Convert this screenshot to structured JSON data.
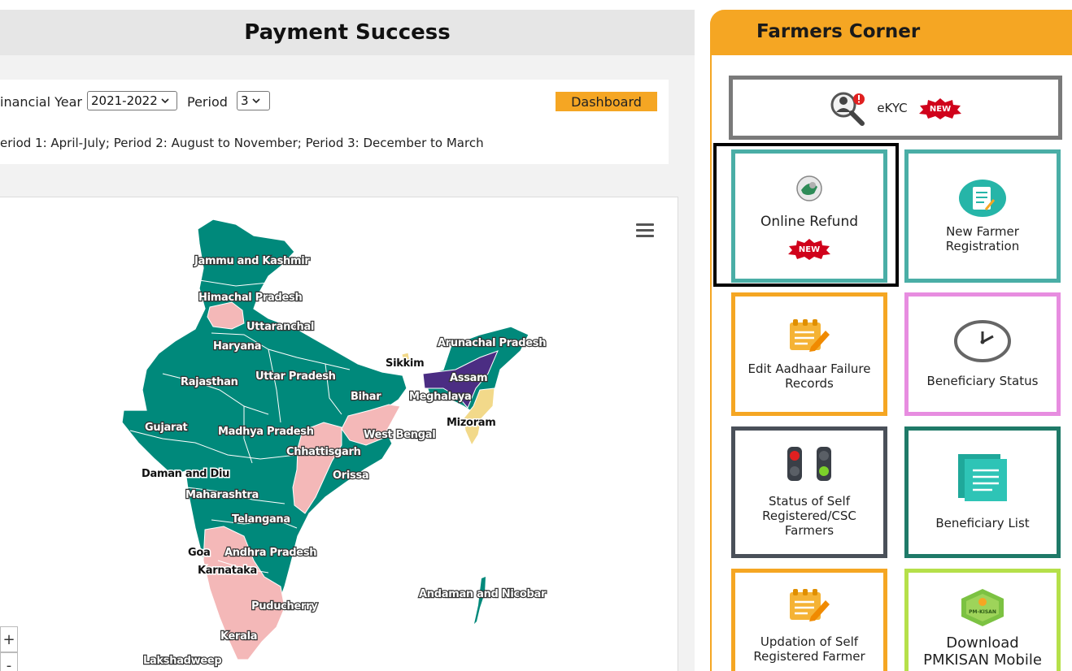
{
  "left": {
    "title": "Payment Success",
    "financial_year_label": "inancial Year",
    "financial_year_value": "2021-2022",
    "period_label": "Period",
    "period_value": "3",
    "dashboard_label": "Dashboard",
    "period_note": "eriod 1: April-July; Period 2: August to November; Period 3: December to March"
  },
  "map": {
    "zoom_in": "+",
    "zoom_out": "-",
    "colors": {
      "teal": "#00897b",
      "pink": "#f4b8b8",
      "purple": "#4b2d83",
      "yellow": "#f2d98a"
    },
    "labels": {
      "jk": "Jammu and Kashmir",
      "hp": "Himachal Pradesh",
      "uk": "Uttaranchal",
      "hr": "Haryana",
      "up": "Uttar Pradesh",
      "rj": "Rajasthan",
      "br": "Bihar",
      "sk": "Sikkim",
      "ar": "Arunachal Pradesh",
      "as": "Assam",
      "ml": "Meghalaya",
      "mz": "Mizoram",
      "gj": "Gujarat",
      "mp": "Madhya Pradesh",
      "wb": "West Bengal",
      "cg": "Chhattisgarh",
      "dd": "Daman and Diu",
      "or": "Orissa",
      "mh": "Maharashtra",
      "tg": "Telangana",
      "goa": "Goa",
      "ap": "Andhra Pradesh",
      "ka": "Karnataka",
      "an": "Andaman and Nicobar",
      "py": "Puducherry",
      "kl": "Kerala",
      "ld": "Lakshadweep"
    }
  },
  "right": {
    "title": "Farmers Corner",
    "new_badge": "NEW",
    "tiles": {
      "ekyc": "eKYC",
      "online_refund": "Online Refund",
      "new_farmer": "New Farmer\nRegistration",
      "edit_aadhaar": "Edit Aadhaar Failure\nRecords",
      "beneficiary_status": "Beneficiary Status",
      "status_self": "Status of Self\nRegistered/CSC\nFarmers",
      "beneficiary_list": "Beneficiary List",
      "updation_self": "Updation of Self\nRegistered Farmer",
      "download_app": "Download\nPMKISAN Mobile"
    },
    "logo_text": "PM-KISAN"
  }
}
